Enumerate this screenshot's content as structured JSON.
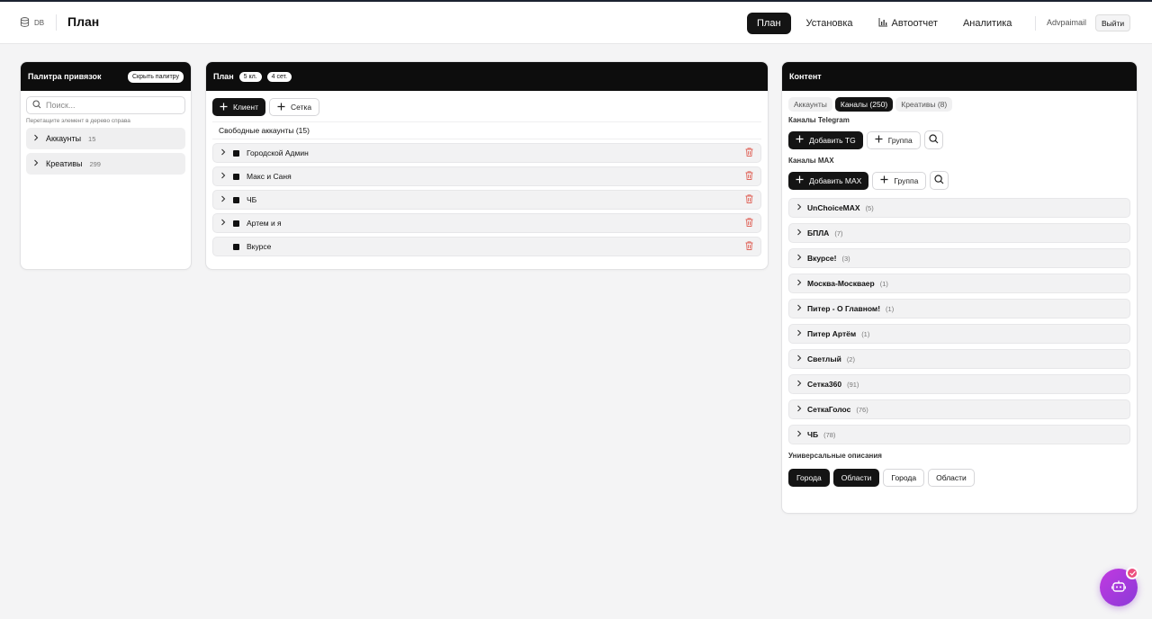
{
  "header": {
    "db_label": "DB",
    "title": "План",
    "nav": [
      {
        "label": "План",
        "active": true
      },
      {
        "label": "Установка"
      },
      {
        "label": "Автоотчет",
        "icon": "bar-chart-icon"
      },
      {
        "label": "Аналитика"
      }
    ],
    "user": "Advpaimail",
    "logout_label": "Выйти"
  },
  "palette": {
    "title": "Палитра привязок",
    "hide_button": "Скрыть палитру",
    "search_placeholder": "Поиск...",
    "hint": "Перетащите элемент в дерево справа",
    "items": [
      {
        "label": "Аккаунты",
        "count": "15"
      },
      {
        "label": "Креативы",
        "count": "299"
      }
    ]
  },
  "plan": {
    "title": "План",
    "badges": [
      "5 кл.",
      "4 сет."
    ],
    "add_client": "Клиент",
    "add_network": "Сетка",
    "free_accounts": "Свободные аккаунты (15)",
    "clients": [
      {
        "label": "Городской Админ",
        "expandable": true
      },
      {
        "label": "Макс и Саня",
        "expandable": true
      },
      {
        "label": "ЧБ",
        "expandable": true
      },
      {
        "label": "Артем и я",
        "expandable": true
      },
      {
        "label": "Вкурсе",
        "expandable": false
      }
    ]
  },
  "content": {
    "title": "Контент",
    "tabs": [
      {
        "label": "Аккаунты"
      },
      {
        "label": "Каналы (250)",
        "active": true
      },
      {
        "label": "Креативы (8)"
      }
    ],
    "telegram_section": "Каналы Telegram",
    "add_tg": "Добавить TG",
    "group_label": "Группа",
    "max_section": "Каналы MAX",
    "add_max": "Добавить MAX",
    "channels": [
      {
        "label": "UnChoiceMAX",
        "count": "(5)"
      },
      {
        "label": "БПЛА",
        "count": "(7)"
      },
      {
        "label": "Вкурсе!",
        "count": "(3)"
      },
      {
        "label": "Москва-Москваер",
        "count": "(1)"
      },
      {
        "label": "Питер - О Главном!",
        "count": "(1)"
      },
      {
        "label": "Питер Артём",
        "count": "(1)"
      },
      {
        "label": "Светлый",
        "count": "(2)"
      },
      {
        "label": "Сетка360",
        "count": "(91)"
      },
      {
        "label": "СеткаГолос",
        "count": "(76)"
      },
      {
        "label": "ЧБ",
        "count": "(78)"
      }
    ],
    "universal_section": "Универсальные описания",
    "universal_chips": [
      {
        "label": "Города",
        "dark": true
      },
      {
        "label": "Области",
        "dark": true
      },
      {
        "label": "Города",
        "dark": false
      },
      {
        "label": "Области",
        "dark": false
      }
    ]
  },
  "colors": {
    "accent_dark": "#141414",
    "trash_red": "#e0665c",
    "fab_gradient_start": "#c13ae0",
    "fab_gradient_end": "#8b3ad8"
  }
}
